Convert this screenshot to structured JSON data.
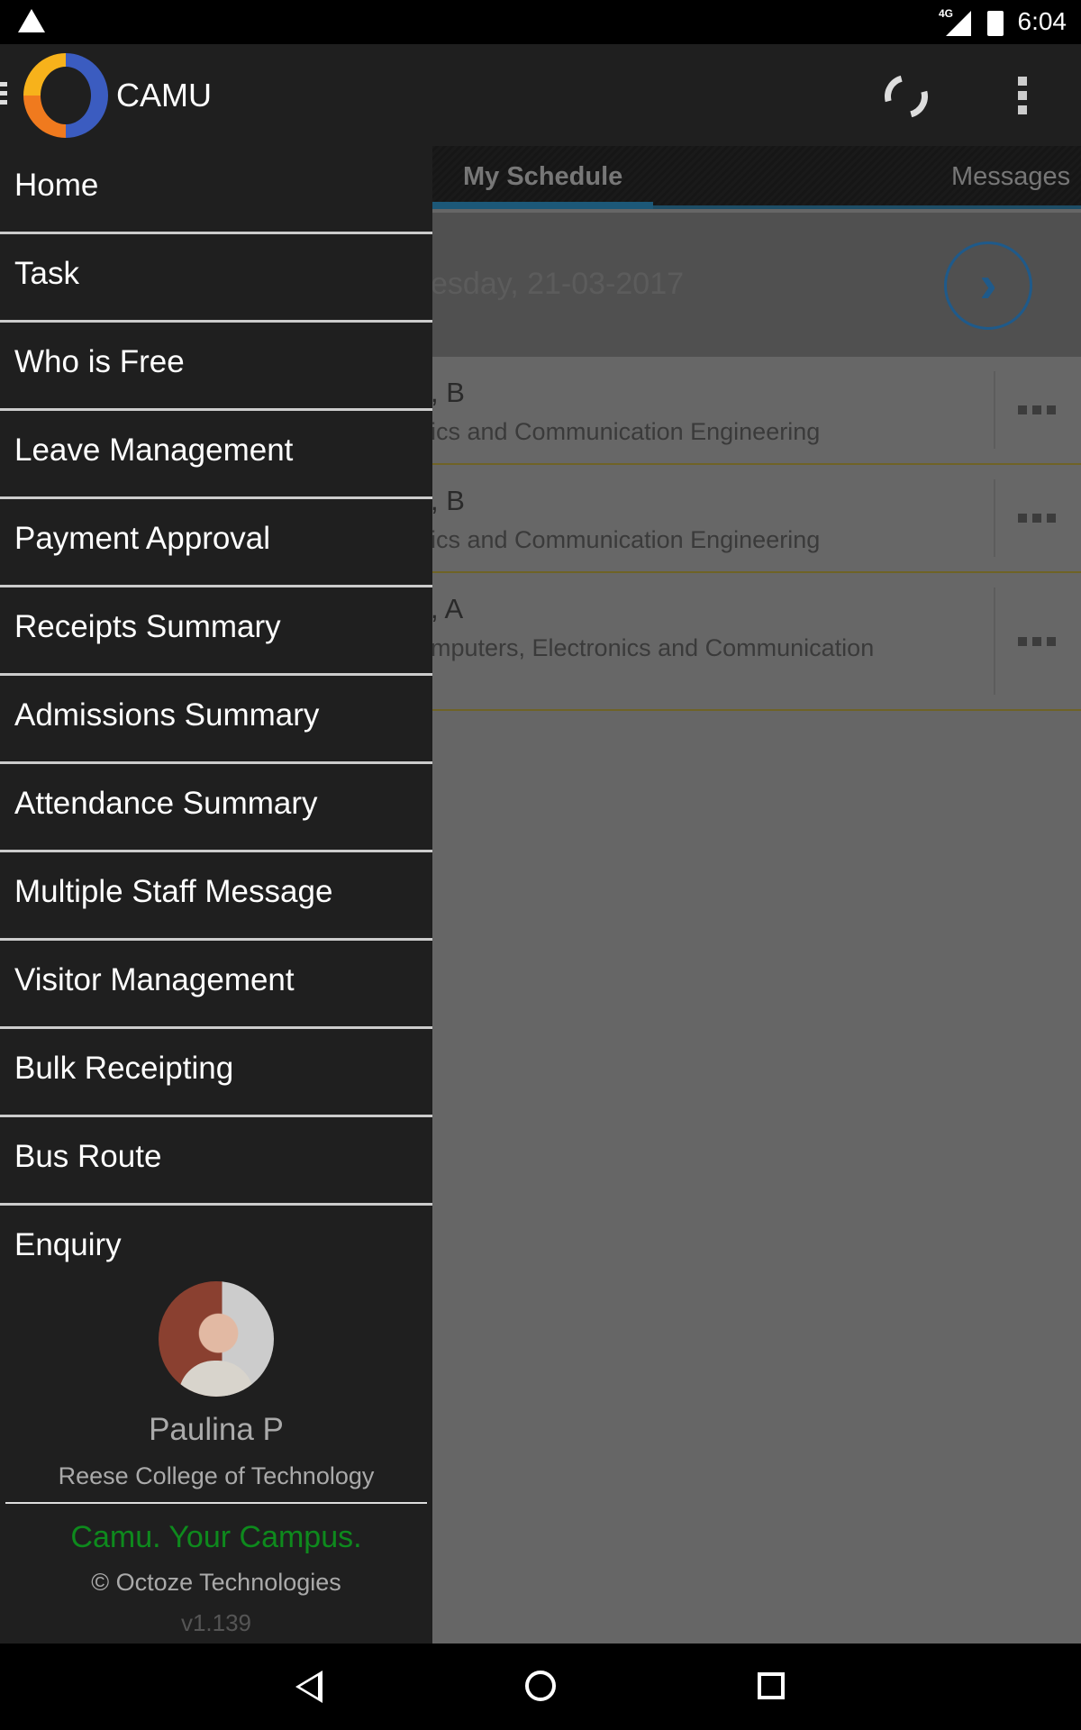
{
  "status_bar": {
    "network": "4G",
    "time": "6:04",
    "icons": [
      "warning-icon",
      "signal-icon",
      "battery-charging-icon"
    ]
  },
  "app_bar": {
    "title": "CAMU",
    "actions": [
      "sync-icon",
      "more-vert-icon"
    ]
  },
  "tabs": [
    {
      "label": "My Schedule",
      "active": true
    },
    {
      "label": "Messages",
      "active": false
    }
  ],
  "schedule": {
    "date": "esday, 21-03-2017",
    "rows": [
      {
        "title": ", B",
        "subtitle": "ics and Communication Engineering"
      },
      {
        "title": ", B",
        "subtitle": "ics and Communication Engineering"
      },
      {
        "title": ", A",
        "subtitle": "mputers, Electronics and Communication"
      }
    ]
  },
  "drawer": {
    "items": [
      "Home",
      "Task",
      "Who is Free",
      "Leave Management",
      "Payment Approval",
      "Receipts Summary",
      "Admissions Summary",
      "Attendance Summary",
      "Multiple Staff Message",
      "Visitor Management",
      "Bulk Receipting",
      "Bus Route",
      "Enquiry"
    ],
    "profile": {
      "name": "Paulina  P",
      "college": "Reese College of Technology"
    },
    "tagline": "Camu. Your Campus.",
    "copyright": "© Octoze Technologies",
    "version": "v1.139"
  },
  "colors": {
    "tagline": "#0e8a1d",
    "tab_indicator": "#1c5878",
    "drawer_bg": "#1f1f1f"
  }
}
